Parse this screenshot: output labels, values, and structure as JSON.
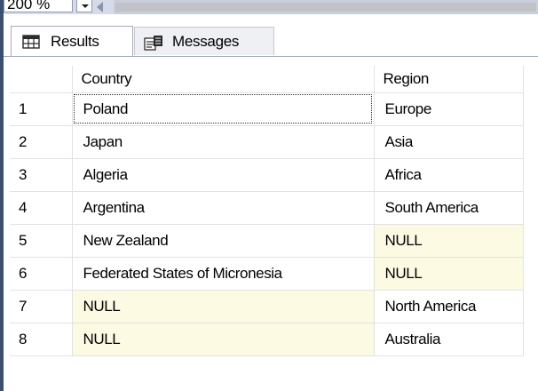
{
  "toolbar": {
    "zoom_value": "200 %"
  },
  "tabs": [
    {
      "label": "Results",
      "icon": "grid-icon",
      "active": true
    },
    {
      "label": "Messages",
      "icon": "messages-icon",
      "active": false
    }
  ],
  "grid": {
    "columns": [
      "",
      "Country",
      "Region"
    ],
    "rows": [
      {
        "num": "1",
        "country": "Poland",
        "region": "Europe"
      },
      {
        "num": "2",
        "country": "Japan",
        "region": "Asia"
      },
      {
        "num": "3",
        "country": "Algeria",
        "region": "Africa"
      },
      {
        "num": "4",
        "country": "Argentina",
        "region": "South America"
      },
      {
        "num": "5",
        "country": "New Zealand",
        "region": "NULL"
      },
      {
        "num": "6",
        "country": "Federated States of Micronesia",
        "region": "NULL"
      },
      {
        "num": "7",
        "country": "NULL",
        "region": "North America"
      },
      {
        "num": "8",
        "country": "NULL",
        "region": "Australia"
      }
    ],
    "selected_cell": "row 1 country",
    "null_highlight_color": "#fcfae2"
  },
  "colors": {
    "window_edge": "#3b4f73",
    "strip_background": "#d6dbe9",
    "tab_border": "#a3aab8"
  }
}
